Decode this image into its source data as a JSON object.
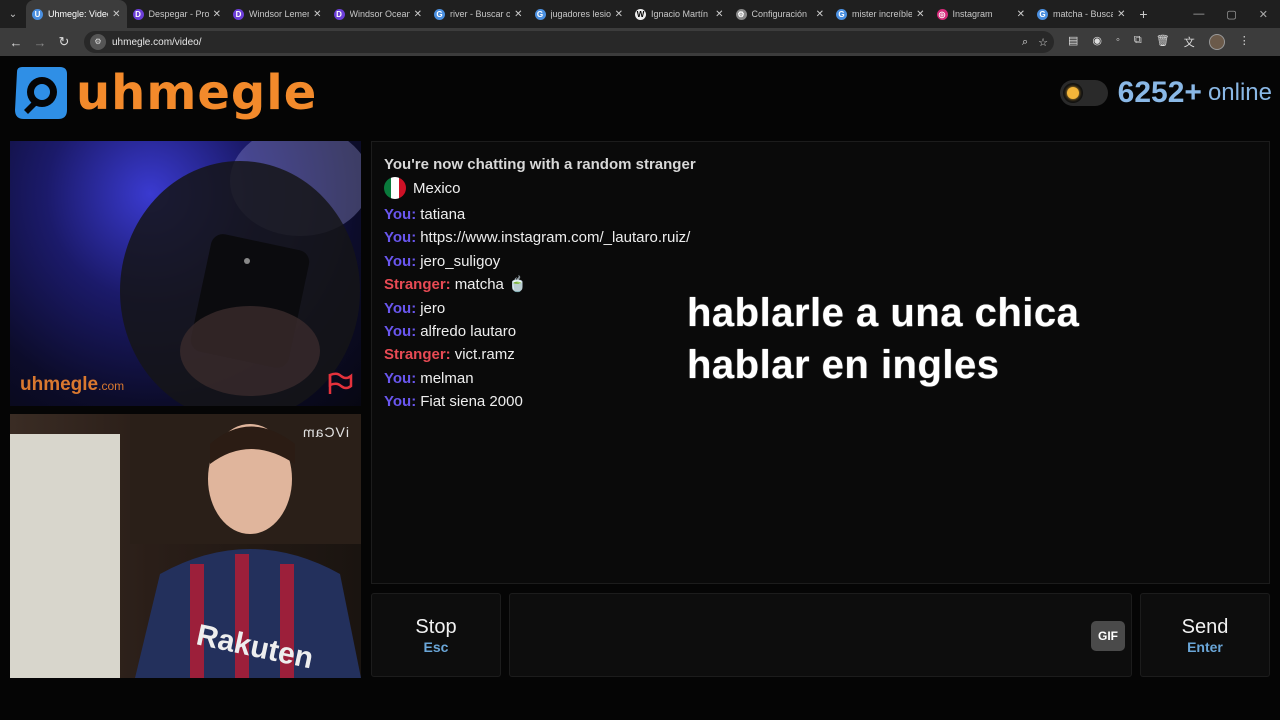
{
  "browser": {
    "tabs": [
      {
        "label": "Uhmegle: Video",
        "color": "#4a8fe0",
        "glyph": "U",
        "active": true
      },
      {
        "label": "Despegar - Prof",
        "color": "#6c3ed8",
        "glyph": "D"
      },
      {
        "label": "Windsor Lemer",
        "color": "#6c3ed8",
        "glyph": "D"
      },
      {
        "label": "Windsor Ocean",
        "color": "#6c3ed8",
        "glyph": "D"
      },
      {
        "label": "river - Buscar c",
        "color": "#4a8fe0",
        "glyph": "G"
      },
      {
        "label": "jugadores lesio",
        "color": "#4a8fe0",
        "glyph": "G"
      },
      {
        "label": "Ignacio Martín",
        "color": "#eeeeee",
        "glyph": "W"
      },
      {
        "label": "Configuración",
        "color": "#888888",
        "glyph": "⚙"
      },
      {
        "label": "mister increíble",
        "color": "#4a8fe0",
        "glyph": "G"
      },
      {
        "label": "Instagram",
        "color": "#d6297a",
        "glyph": "◎"
      },
      {
        "label": "matcha - Busca",
        "color": "#4a8fe0",
        "glyph": "G"
      }
    ],
    "url": "uhmegle.com/video/"
  },
  "header": {
    "logo_text": "uhmegle",
    "online_count": "6252+",
    "online_label": "online"
  },
  "videos": {
    "watermark_main": "uhmegle",
    "watermark_suffix": ".com",
    "self_cam_label": "iVCam"
  },
  "chat": {
    "status": "You're now chatting with a random stranger",
    "country": "Mexico",
    "you_label": "You:",
    "stranger_label": "Stranger:",
    "messages": [
      {
        "from": "you",
        "text": "tatiana"
      },
      {
        "from": "you",
        "text": "https://www.instagram.com/_lautaro.ruiz/"
      },
      {
        "from": "you",
        "text": "jero_suligoy"
      },
      {
        "from": "stranger",
        "text": "matcha 🍵"
      },
      {
        "from": "you",
        "text": "jero"
      },
      {
        "from": "you",
        "text": "alfredo lautaro"
      },
      {
        "from": "stranger",
        "text": "vict.ramz"
      },
      {
        "from": "you",
        "text": "melman"
      },
      {
        "from": "you",
        "text": "Fiat siena 2000"
      }
    ],
    "overlay_lines": [
      "hablarle a una chica",
      "hablar en ingles"
    ]
  },
  "controls": {
    "stop_label": "Stop",
    "stop_key": "Esc",
    "gif_label": "GIF",
    "send_label": "Send",
    "send_key": "Enter"
  }
}
